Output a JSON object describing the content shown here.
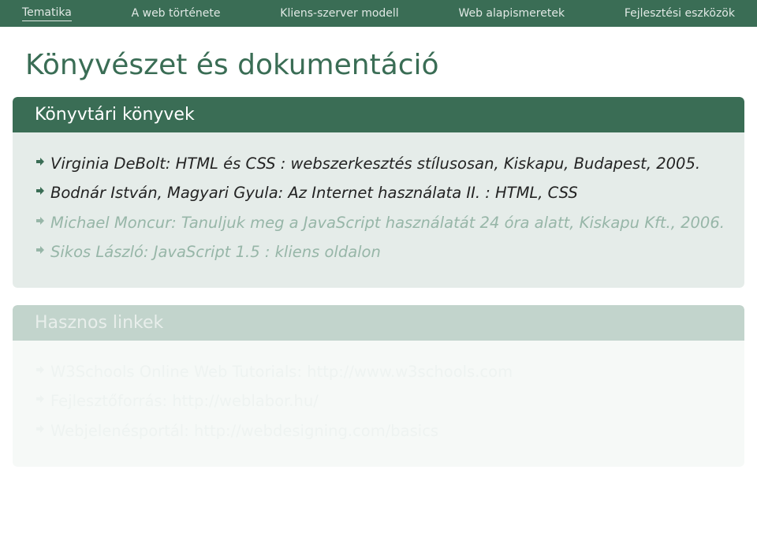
{
  "nav": {
    "items": [
      {
        "label": "Tematika",
        "active": true
      },
      {
        "label": "A web története",
        "active": false
      },
      {
        "label": "Kliens-szerver modell",
        "active": false
      },
      {
        "label": "Web alapismeretek",
        "active": false
      },
      {
        "label": "Fejlesztési eszközök",
        "active": false
      }
    ]
  },
  "title": "Könyvészet és dokumentáció",
  "block1": {
    "title": "Könyvtári könyvek",
    "items": [
      {
        "text": "Virginia DeBolt: HTML és CSS : webszerkesztés stílusosan, Kiskapu, Budapest, 2005.",
        "italic": true,
        "strong": true
      },
      {
        "text": "Bodnár István, Magyari Gyula: Az Internet használata II. : HTML, CSS",
        "italic": true,
        "strong": true
      },
      {
        "text": "Michael Moncur: Tanuljuk meg a JavaScript használatát 24 óra alatt, Kiskapu Kft., 2006.",
        "italic": true,
        "strong": false
      },
      {
        "text": "Sikos László: JavaScript 1.5 : kliens oldalon",
        "italic": true,
        "strong": false
      }
    ]
  },
  "block2": {
    "title": "Hasznos linkek",
    "items": [
      {
        "text": "W3Schools Online Web Tutorials: http://www.w3schools.com"
      },
      {
        "text": "Fejlesztőforrás: http://weblabor.hu/"
      },
      {
        "text": "Webjelenésportál: http://webdesigning.com/basics"
      }
    ]
  },
  "colors": {
    "accent": "#3a6d55",
    "fadedAccent": "#97b6a8"
  }
}
